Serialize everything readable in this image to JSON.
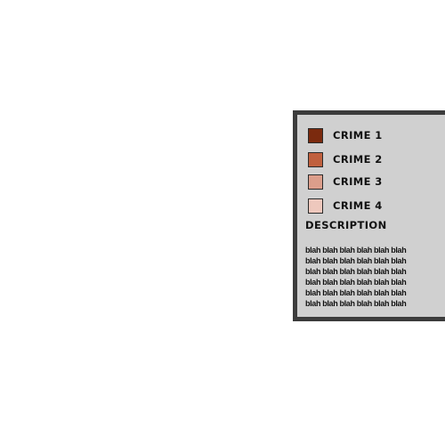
{
  "legend": {
    "items": [
      {
        "label": "CRIME 1",
        "color": "#7b2a0e"
      },
      {
        "label": "CRIME 2",
        "color": "#c0603e"
      },
      {
        "label": "CRIME 3",
        "color": "#dc9e8b"
      },
      {
        "label": "CRIME 4",
        "color": "#eec8bd"
      }
    ],
    "description_heading": "DESCRIPTION",
    "description_lines": [
      "blah blah blah blah blah blah",
      "blah blah blah blah blah blah",
      "blah blah blah blah blah blah",
      "blah blah blah blah blah blah",
      "blah blah blah blah blah blah",
      "blah blah blah blah blah blah"
    ],
    "panel_background": "#d0d0d0",
    "panel_border": "#3c3c3c"
  }
}
